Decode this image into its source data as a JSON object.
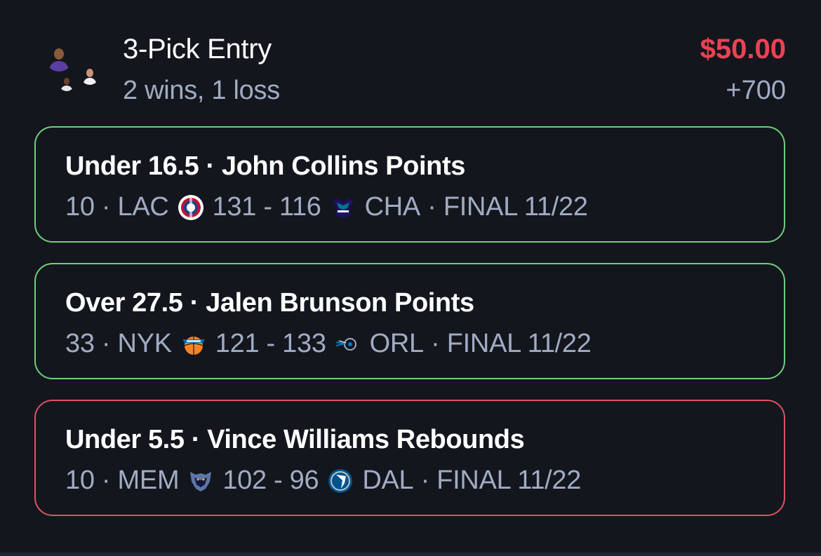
{
  "entry": {
    "title": "3-Pick Entry",
    "record": "2 wins, 1 loss",
    "amount": "$50.00",
    "odds": "+700"
  },
  "colors": {
    "background": "#13161d",
    "win_border": "#6fcf7a",
    "loss_border": "#db5462",
    "amount_red": "#ec4253",
    "muted_text": "#a1acc3"
  },
  "picks": [
    {
      "result": "win",
      "title": "Under 16.5 · John Collins Points",
      "stat": "10",
      "team_a": "LAC",
      "team_a_icon": "clippers-logo-icon",
      "score": "131 - 116",
      "team_b": "CHA",
      "team_b_icon": "hornets-logo-icon",
      "status": "FINAL 11/22"
    },
    {
      "result": "win",
      "title": "Over 27.5 · Jalen Brunson Points",
      "stat": "33",
      "team_a": "NYK",
      "team_a_icon": "knicks-logo-icon",
      "score": "121 - 133",
      "team_b": "ORL",
      "team_b_icon": "magic-logo-icon",
      "status": "FINAL 11/22"
    },
    {
      "result": "loss",
      "title": "Under 5.5 · Vince Williams Rebounds",
      "stat": "10",
      "team_a": "MEM",
      "team_a_icon": "grizzlies-logo-icon",
      "score": "102 - 96",
      "team_b": "DAL",
      "team_b_icon": "mavericks-logo-icon",
      "status": "FINAL 11/22"
    }
  ]
}
